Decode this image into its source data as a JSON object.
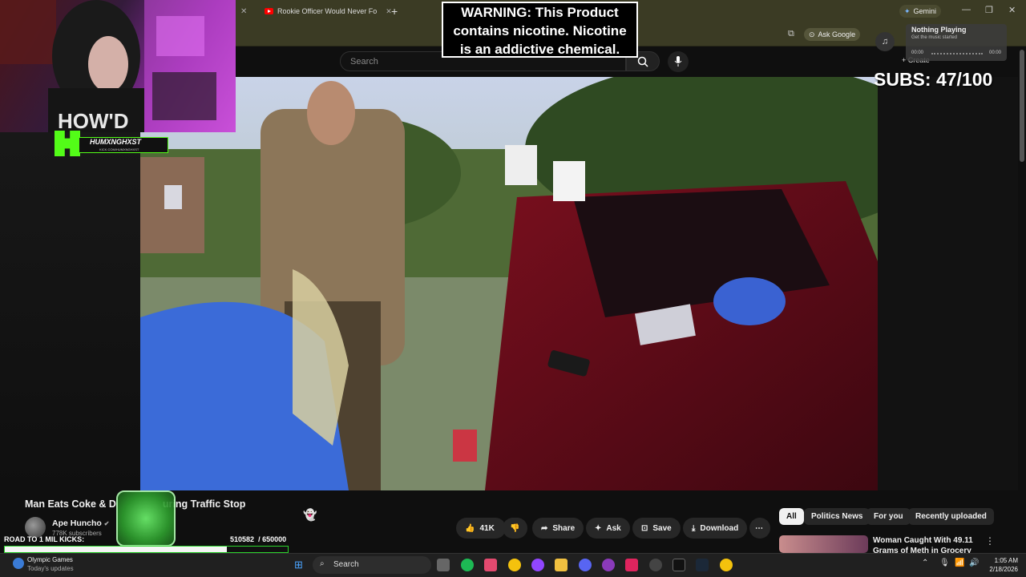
{
  "browser": {
    "tab_title": "Rookie Officer Would Never Fo",
    "gemini_label": "Gemini",
    "ask_google_label": "Ask Google"
  },
  "youtube": {
    "search_placeholder": "Search",
    "create_label": "Create"
  },
  "overlay": {
    "warning_lines": [
      "WARNING: This Product",
      "contains nicotine. Nicotine",
      "is an addictive chemical."
    ],
    "subs": "SUBS: 47/100",
    "music_title": "Nothing Playing",
    "music_sub": "Get the music started",
    "music_time_start": "00:00",
    "music_time_end": "00:00",
    "kick_handle": "HUMXNGHXST",
    "kick_url": "KICK.COM/HUMXNGHXST",
    "road_label": "ROAD TO 1 MIL KICKS:",
    "road_count": "510582",
    "road_goal": "/ 650000",
    "road_progress": 0.785
  },
  "video": {
    "title": "Man Eats Coke & D",
    "title_tail": "uring Traffic Stop",
    "channel": "Ape Huncho",
    "subscribers": "778K subscribers",
    "likes": "41K",
    "share_label": "Share",
    "ask_label": "Ask",
    "save_label": "Save",
    "download_label": "Download"
  },
  "filters": [
    "All",
    "Politics News",
    "For you",
    "Recently uploaded"
  ],
  "recommendation": {
    "title_line1": "Woman Caught With 49.11",
    "title_line2": "Grams of Meth in Grocery Store"
  },
  "taskbar": {
    "news_title": "Olympic Games",
    "news_sub": "Today's updates",
    "search_label": "Search",
    "time": "1:05 AM",
    "date": "2/18/2026"
  },
  "colors": {
    "yt_red": "#ff0000",
    "kick_green": "#2bd42b",
    "chip_bg": "#272727"
  }
}
